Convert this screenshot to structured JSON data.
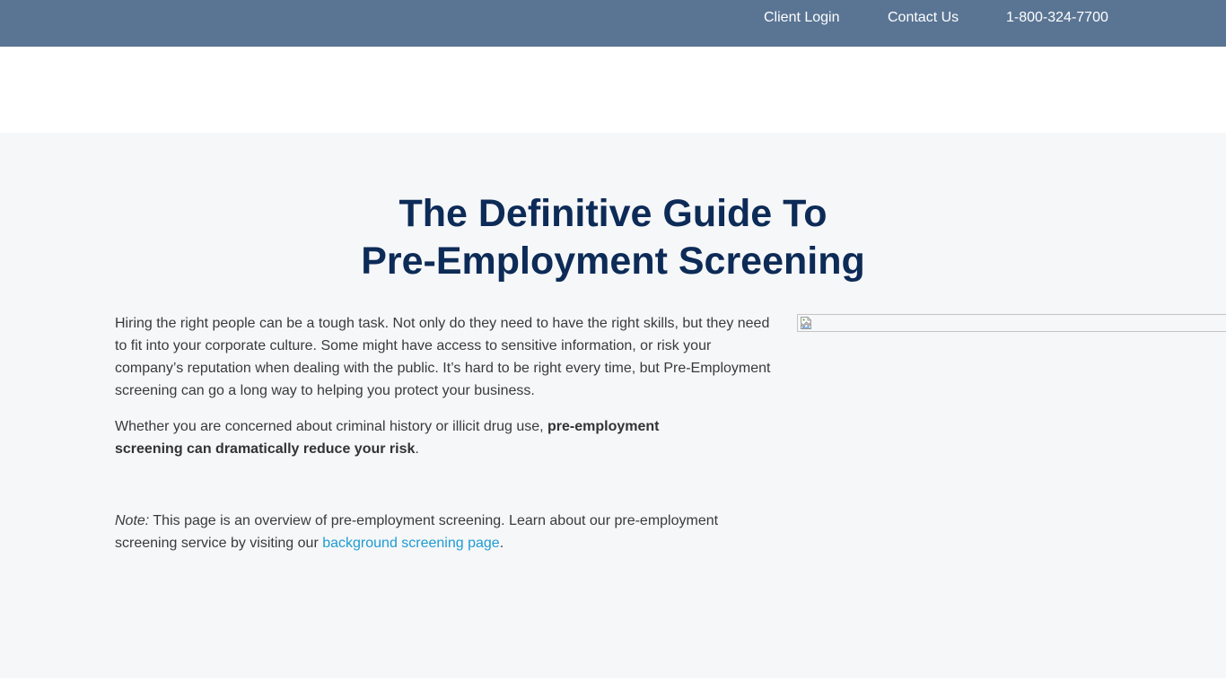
{
  "topnav": {
    "client_login": "Client Login",
    "contact_us": "Contact Us",
    "phone": "1-800-324-7700"
  },
  "hero": {
    "title_line1": "The Definitive Guide To",
    "title_line2": "Pre-Employment Screening"
  },
  "content": {
    "paragraph1": "Hiring the right people can be a tough task. Not only do they need to have the right skills, but they need to fit into your corporate culture. Some might have access to sensitive information, or risk your company’s reputation when dealing with the public. It’s hard to be right every time, but Pre-Employment screening can go a long way to helping you protect your business.",
    "paragraph2_prefix": "Whether you are concerned about criminal history or illicit drug use, ",
    "paragraph2_bold": "pre-employment screening can dramatically reduce your risk",
    "paragraph2_suffix": ".",
    "note_label": "Note:",
    "note_text": " This page is an overview of pre-employment screening. Learn about our pre-employment screening service by visiting our ",
    "note_link": "background screening page",
    "note_suffix": "."
  },
  "image": {
    "icon": "broken-image-icon"
  },
  "colors": {
    "topbar": "#5a7594",
    "title": "#0d2b57",
    "link": "#1e9bd3",
    "main_bg": "#f6f7f9"
  }
}
